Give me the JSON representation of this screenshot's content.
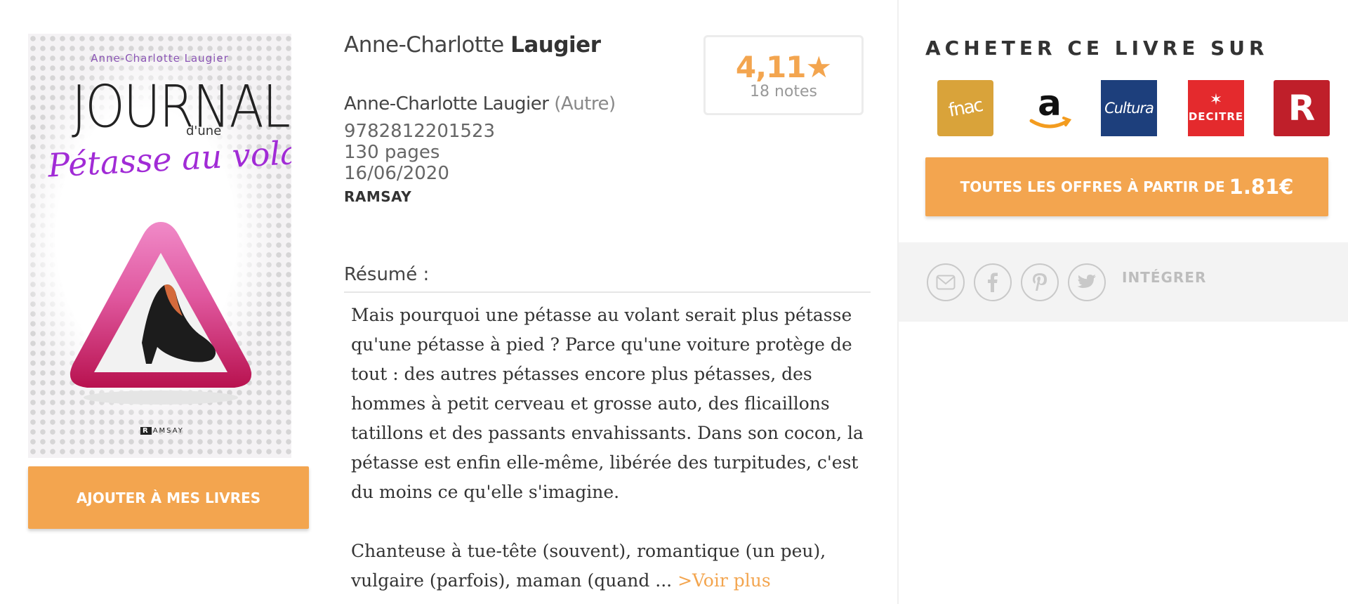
{
  "cover": {
    "author": "Anne-Charlotte Laugier",
    "title_main": "JOURNAL",
    "title_small": "d'une",
    "subtitle": "Pétasse au volant",
    "publisher_mark": "R",
    "publisher_text": "AMSAY"
  },
  "add_button_label": "AJOUTER À MES LIVRES",
  "book": {
    "author_first": "Anne-Charlotte",
    "author_last": "Laugier",
    "contributor_name": "Anne-Charlotte Laugier",
    "contributor_role": "(Autre)",
    "isbn": "9782812201523",
    "pages": "130 pages",
    "date": "16/06/2020",
    "publisher": "RAMSAY"
  },
  "rating": {
    "value": "4,11★",
    "count": "18 notes"
  },
  "resume": {
    "label": "Résumé :",
    "paragraph1": "Mais pourquoi une pétasse au volant serait plus pétasse qu'une pétasse à pied ? Parce qu'une voiture protège de tout : des autres pétasses encore plus pétasses, des hommes à petit cerveau et grosse auto, des flicaillons tatillons et des passants envahissants. Dans son cocon, la pétasse est enfin elle-même, libérée des turpitudes, c'est du moins ce qu'elle s'imagine.",
    "paragraph2": "Chanteuse à tue-tête (souvent), romantique (un peu), vulgaire (parfois), maman (quand ...",
    "see_more": ">Voir plus"
  },
  "buy": {
    "title": "ACHETER CE LIVRE SUR",
    "stores": {
      "fnac": "fnac",
      "amazon": "a",
      "cultura": "Cultura",
      "decitre_star": "✶",
      "decitre": "DECITRE",
      "rakuten": "R"
    },
    "offers_label": "TOUTES LES OFFRES À PARTIR DE",
    "offers_price": "1.81€"
  },
  "share": {
    "embed_label": "INTÉGRER",
    "icons": [
      "mail-icon",
      "facebook-icon",
      "pinterest-icon",
      "twitter-icon"
    ]
  },
  "colors": {
    "accent": "#f3a54f",
    "fnac": "#d9a33a",
    "cultura": "#1d3f7c",
    "decitre": "#e42a2d",
    "rakuten": "#bf1f2a"
  }
}
